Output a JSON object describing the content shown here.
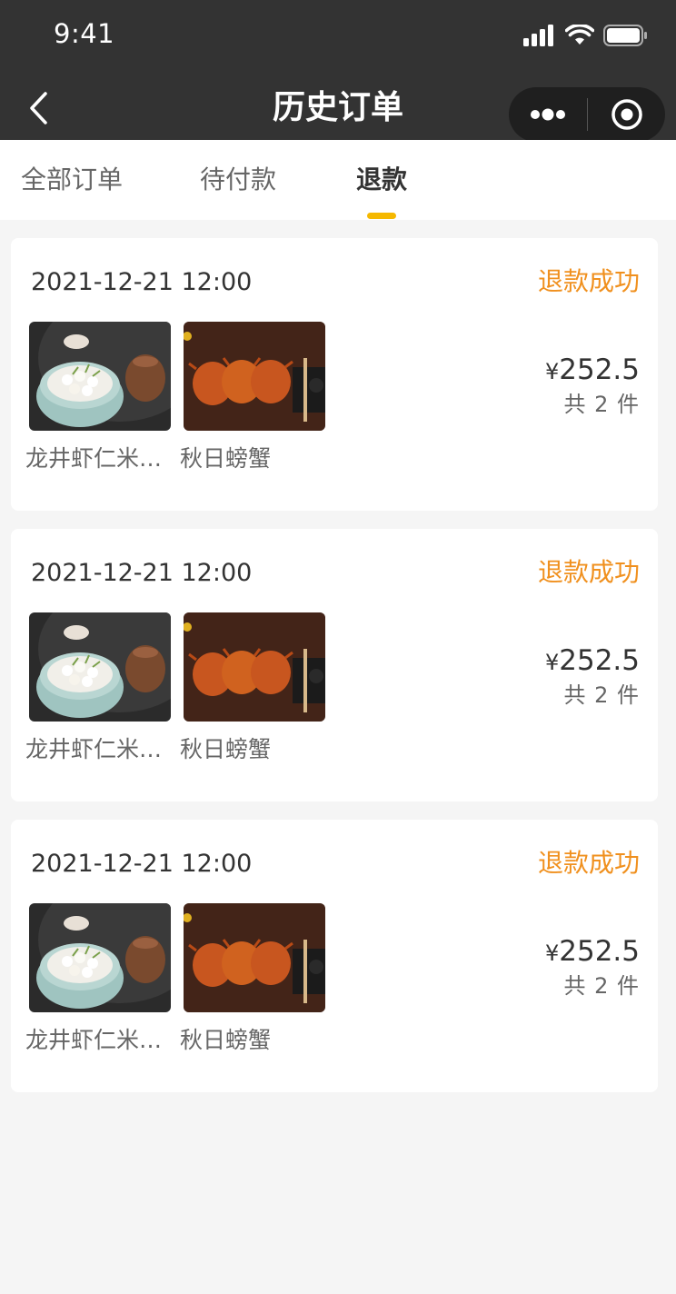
{
  "status_bar": {
    "time": "9:41"
  },
  "nav": {
    "title": "历史订单"
  },
  "tabs": [
    {
      "label": "全部订单",
      "active": false
    },
    {
      "label": "待付款",
      "active": false
    },
    {
      "label": "退款",
      "active": true
    }
  ],
  "orders": [
    {
      "time": "2021-12-21 12:00",
      "status": "退款成功",
      "products": [
        {
          "name": "龙井虾仁米…"
        },
        {
          "name": "秋日螃蟹"
        }
      ],
      "price_symbol": "¥",
      "price": "252.5",
      "count_text": "共 2 件"
    },
    {
      "time": "2021-12-21 12:00",
      "status": "退款成功",
      "products": [
        {
          "name": "龙井虾仁米…"
        },
        {
          "name": "秋日螃蟹"
        }
      ],
      "price_symbol": "¥",
      "price": "252.5",
      "count_text": "共 2 件"
    },
    {
      "time": "2021-12-21 12:00",
      "status": "退款成功",
      "products": [
        {
          "name": "龙井虾仁米…"
        },
        {
          "name": "秋日螃蟹"
        }
      ],
      "price_symbol": "¥",
      "price": "252.5",
      "count_text": "共 2 件"
    }
  ],
  "colors": {
    "nav_bg": "#333333",
    "accent_status": "#f0901e",
    "tab_indicator": "#f5b800",
    "page_bg": "#f5f5f5"
  },
  "icons": [
    "back-chevron-icon",
    "more-dots-icon",
    "close-target-icon",
    "signal-icon",
    "wifi-icon",
    "battery-icon"
  ]
}
